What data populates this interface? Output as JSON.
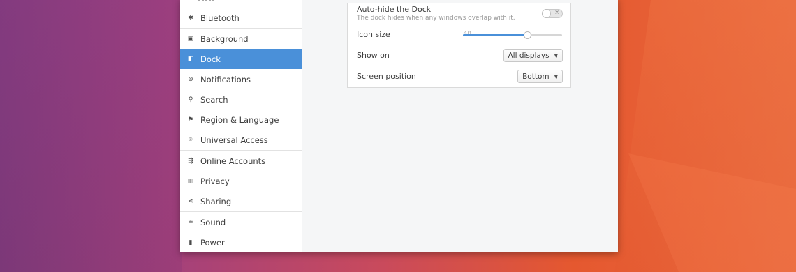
{
  "sidebar": {
    "items": [
      {
        "label": "Bluetooth",
        "icon": "bluetooth-icon",
        "glyph": "✱"
      },
      {
        "label": "Background",
        "icon": "background-icon",
        "glyph": "▣"
      },
      {
        "label": "Dock",
        "icon": "dock-icon",
        "glyph": "◧"
      },
      {
        "label": "Notifications",
        "icon": "notifications-icon",
        "glyph": "⊚"
      },
      {
        "label": "Search",
        "icon": "search-icon",
        "glyph": "⚲"
      },
      {
        "label": "Region & Language",
        "icon": "region-language-icon",
        "glyph": "⚑"
      },
      {
        "label": "Universal Access",
        "icon": "universal-access-icon",
        "glyph": "⍟"
      },
      {
        "label": "Online Accounts",
        "icon": "online-accounts-icon",
        "glyph": "⇶"
      },
      {
        "label": "Privacy",
        "icon": "privacy-icon",
        "glyph": "▥"
      },
      {
        "label": "Sharing",
        "icon": "sharing-icon",
        "glyph": "⋖"
      },
      {
        "label": "Sound",
        "icon": "sound-icon",
        "glyph": "≐"
      },
      {
        "label": "Power",
        "icon": "power-icon",
        "glyph": "▮"
      }
    ],
    "active_index": 2
  },
  "dock_settings": {
    "autohide": {
      "title": "Auto-hide the Dock",
      "subtitle": "The dock hides when any windows overlap with it.",
      "enabled": false
    },
    "icon_size": {
      "label": "Icon size",
      "value": "48",
      "fraction": 0.65
    },
    "show_on": {
      "label": "Show on",
      "selected": "All displays"
    },
    "screen_position": {
      "label": "Screen position",
      "selected": "Bottom"
    }
  },
  "colors": {
    "accent": "#4a90d9"
  }
}
